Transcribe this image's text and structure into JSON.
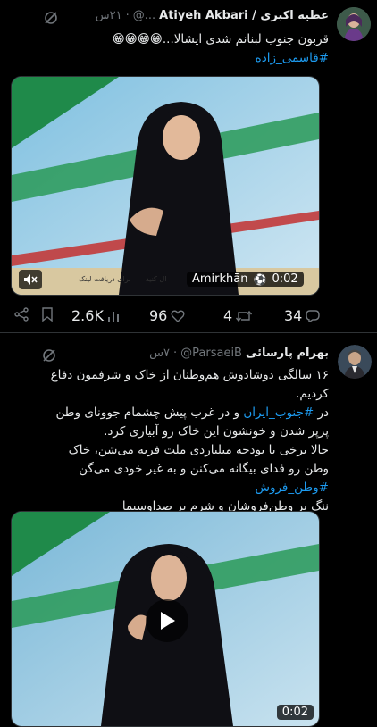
{
  "tweet1": {
    "display_name": "عطیه اکبری / Atiyeh Akbari",
    "handle": "@...",
    "time": "۲۱س",
    "dot": "·",
    "line1": "قربون جنوب لبنانم شدی ایشالا...😁😁😁😁",
    "hashtag": "#قاسمی_زاده",
    "video": {
      "attribution": "Amirkhān",
      "duration": "0:02",
      "caption_strip_left": "برای دریافت لینک",
      "caption_strip_right": "ال کنید"
    },
    "actions": {
      "views": "2.6K",
      "likes": "96",
      "retweets": "4",
      "replies": "34"
    }
  },
  "tweet2": {
    "display_name": "بهرام پارسائی",
    "handle": "@ParsaeiB",
    "time": "۷س",
    "dot": "·",
    "p1": "۱۶ سالگی دوشادوش هم‌وطنان از خاک و شرفمون دفاع کردیم.",
    "p2_prefix": "در ",
    "p2_hash": "#جنوب_ایران",
    "p2_rest": " و در غرب پیش چشمام جوونای وطن پرپر شدن و خونشون این خاک رو آبیاری کرد.",
    "p3_a": "حالا برخی با بودجه میلیاردی ملت فربه می‌شن، خاک وطن رو فدای بیگانه می‌کنن و به غیر خودی می‌گن ",
    "p3_hash": "#وطن_فروش",
    "p3_b": "ننگ بر وطن‌فروشان و شرم بر صداوسیما",
    "video": {
      "duration": "0:02"
    }
  },
  "colors": {
    "accent": "#1d9bf0",
    "muted": "#71767b",
    "bg": "#000000"
  }
}
